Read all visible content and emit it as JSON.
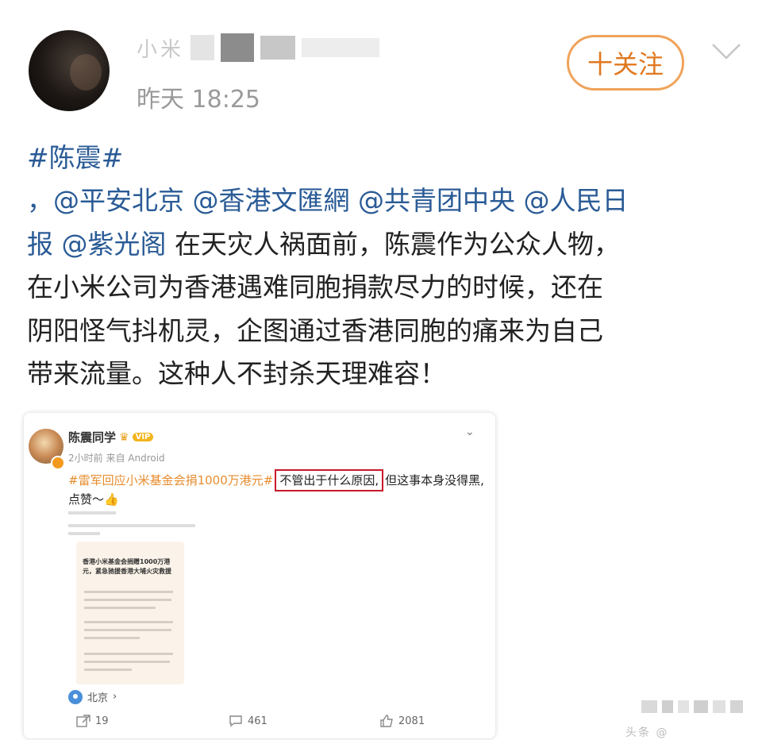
{
  "post": {
    "author_visible": "小米",
    "time": "昨天 18:25",
    "follow_label": "十关注",
    "topic": "#陈震#",
    "mentions": [
      "，@平安北京",
      "@香港文匯網",
      "@共青团中央",
      "@人民日",
      "报",
      "@紫光阁"
    ],
    "text_segment1": "在天灾人祸面前，陈震作为公众人物，",
    "text_line3": "在小米公司为香港遇难同胞捐款尽力的时候，还在",
    "text_line4": "阴阳怪气抖机灵，企图通过香港同胞的痛来为自己",
    "text_line5": "带来流量。这种人不封杀天理难容！"
  },
  "embedded": {
    "name": "陈震同学",
    "vip_badge": "VIP",
    "time_source": "2小时前 来自 Android",
    "hashtag": "#雷军回应小米基金会捐1000万港元#",
    "highlight": "不管出于什么原因,",
    "line1_rest": "但这事本身没得黑,",
    "line2": "点赞～👍",
    "card_title": "香港小米基金会捐赠1000万港元，紧急驰援香港大埔火灾救援",
    "location": "北京",
    "counts": {
      "shares": "19",
      "comments": "461",
      "likes": "2081"
    }
  },
  "watermark": "头条 @"
}
